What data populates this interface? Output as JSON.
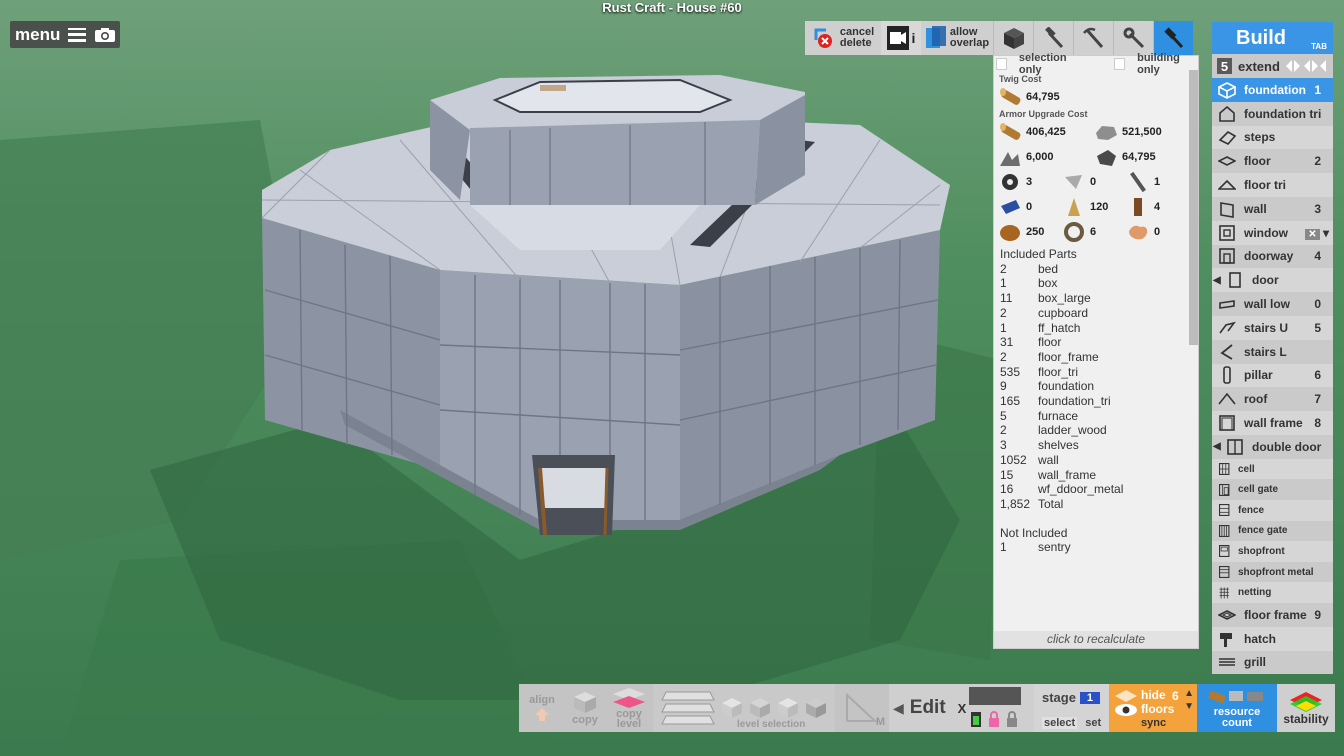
{
  "title": "Rust Craft - House #60",
  "menu": {
    "label": "menu"
  },
  "toolbar": {
    "cancel_delete": [
      "cancel",
      "delete"
    ],
    "allow_overlap": [
      "allow",
      "overlap"
    ],
    "info_mark": "i"
  },
  "panel": {
    "selection_only": "selection only",
    "building_only": "building only",
    "twig_cost_header": "Twig Cost",
    "twig_cost": {
      "icon": "wood-icon",
      "value": "64,795"
    },
    "armor_header": "Armor Upgrade Cost",
    "armor_costs": [
      {
        "icon": "wood-icon",
        "value": "406,425"
      },
      {
        "icon": "stone-icon",
        "value": "521,500"
      },
      {
        "icon": "metal-fragments-icon",
        "value": "6,000"
      },
      {
        "icon": "hqm-icon",
        "value": "64,795"
      },
      {
        "icon": "gear-icon",
        "value": "3"
      },
      {
        "icon": "sheet-metal-icon",
        "value": "0"
      },
      {
        "icon": "pipe-icon",
        "value": "1"
      },
      {
        "icon": "tarp-icon",
        "value": "0"
      },
      {
        "icon": "cloth-icon",
        "value": "120"
      },
      {
        "icon": "log-icon",
        "value": "4"
      },
      {
        "icon": "leather-icon",
        "value": "250"
      },
      {
        "icon": "rope-icon",
        "value": "6"
      },
      {
        "icon": "hide-icon",
        "value": "0"
      }
    ],
    "included_header": "Included Parts",
    "included_parts": [
      {
        "qty": "2",
        "name": "bed"
      },
      {
        "qty": "1",
        "name": "box"
      },
      {
        "qty": "11",
        "name": "box_large"
      },
      {
        "qty": "2",
        "name": "cupboard"
      },
      {
        "qty": "1",
        "name": "ff_hatch"
      },
      {
        "qty": "31",
        "name": "floor"
      },
      {
        "qty": "2",
        "name": "floor_frame"
      },
      {
        "qty": "535",
        "name": "floor_tri"
      },
      {
        "qty": "9",
        "name": "foundation"
      },
      {
        "qty": "165",
        "name": "foundation_tri"
      },
      {
        "qty": "5",
        "name": "furnace"
      },
      {
        "qty": "2",
        "name": "ladder_wood"
      },
      {
        "qty": "3",
        "name": "shelves"
      },
      {
        "qty": "1052",
        "name": "wall"
      },
      {
        "qty": "15",
        "name": "wall_frame"
      },
      {
        "qty": "16",
        "name": "wf_ddoor_metal"
      },
      {
        "qty": "1,852",
        "name": "Total"
      }
    ],
    "not_included_header": "Not Included",
    "not_included": [
      {
        "qty": "1",
        "name": "sentry"
      }
    ],
    "recalc": "click to recalculate"
  },
  "build": {
    "title": "Build",
    "tab_hint": "TAB",
    "extend_num": "5",
    "extend_label": "extend",
    "items": [
      {
        "label": "foundation",
        "key": "1",
        "icon": "foundation-icon",
        "active": true
      },
      {
        "label": "foundation tri",
        "key": "",
        "icon": "foundation-tri-icon"
      },
      {
        "label": "steps",
        "key": "",
        "icon": "steps-icon"
      },
      {
        "label": "floor",
        "key": "2",
        "icon": "floor-icon"
      },
      {
        "label": "floor tri",
        "key": "",
        "icon": "floor-tri-icon"
      },
      {
        "label": "wall",
        "key": "3",
        "icon": "wall-icon"
      },
      {
        "label": "window",
        "key": "",
        "icon": "window-icon"
      },
      {
        "label": "doorway",
        "key": "4",
        "icon": "doorway-icon"
      },
      {
        "label": "door",
        "key": "",
        "icon": "door-icon",
        "arrow": true
      },
      {
        "label": "wall low",
        "key": "0",
        "icon": "wall-low-icon"
      },
      {
        "label": "stairs U",
        "key": "5",
        "icon": "stairs-u-icon"
      },
      {
        "label": "stairs L",
        "key": "",
        "icon": "stairs-l-icon"
      },
      {
        "label": "pillar",
        "key": "6",
        "icon": "pillar-icon"
      },
      {
        "label": "roof",
        "key": "7",
        "icon": "roof-icon"
      },
      {
        "label": "wall frame",
        "key": "8",
        "icon": "wall-frame-icon"
      },
      {
        "label": "double door",
        "key": "",
        "icon": "double-door-icon",
        "arrow": true
      },
      {
        "label": "cell",
        "key": "",
        "icon": "cell-icon",
        "small": true
      },
      {
        "label": "cell gate",
        "key": "",
        "icon": "cell-gate-icon",
        "small": true
      },
      {
        "label": "fence",
        "key": "",
        "icon": "fence-icon",
        "small": true
      },
      {
        "label": "fence gate",
        "key": "",
        "icon": "fence-gate-icon",
        "small": true
      },
      {
        "label": "shopfront",
        "key": "",
        "icon": "shopfront-icon",
        "small": true
      },
      {
        "label": "shopfront metal",
        "key": "",
        "icon": "shopfront-metal-icon",
        "small": true
      },
      {
        "label": "netting",
        "key": "",
        "icon": "netting-icon",
        "small": true
      },
      {
        "label": "floor frame",
        "key": "9",
        "icon": "floor-frame-icon"
      },
      {
        "label": "hatch",
        "key": "",
        "icon": "hatch-icon"
      },
      {
        "label": "grill",
        "key": "",
        "icon": "grill-icon"
      }
    ]
  },
  "bottom": {
    "align": "align",
    "copy": "copy",
    "copy_level": [
      "copy",
      "level"
    ],
    "level_selection": "level selection",
    "m_label": "M",
    "edit": "Edit",
    "x_label": "X",
    "stage": "stage",
    "stage_num": "1",
    "select": "select",
    "set": "set",
    "hide": "hide",
    "floors": "floors",
    "floors_count": "6",
    "sync": "sync",
    "resource_count": [
      "resource",
      "count"
    ],
    "stability": "stability"
  },
  "colors": {
    "accent_blue": "#3a95e6",
    "hide_orange": "#f4a23b",
    "grass": "#3f7d4f"
  }
}
